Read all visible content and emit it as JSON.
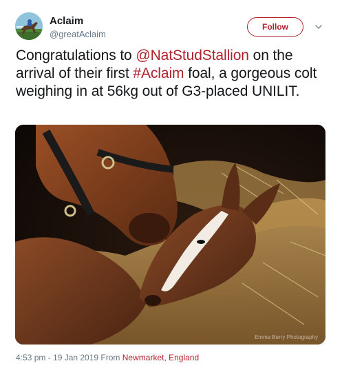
{
  "user": {
    "display_name": "Aclaim",
    "handle": "@greatAclaim"
  },
  "follow_button": {
    "label": "Follow"
  },
  "tweet": {
    "text_part1": "Congratulations to ",
    "mention": "@NatStudStallion",
    "text_part2": " on the arrival of their first ",
    "hashtag": "#Aclaim",
    "text_part3": " foal, a gorgeous colt weighing in at 56kg out of G3-placed UNILIT."
  },
  "photo": {
    "watermark": "Emma Berry Photography"
  },
  "footer": {
    "timestamp": "4:53 pm - 19 Jan 2019",
    "from_label": " From ",
    "location": "Newmarket, England"
  },
  "colors": {
    "accent": "#b0212c",
    "text": "#14171a",
    "secondary": "#657786"
  },
  "icons": {
    "menu": "chevron-down-icon"
  }
}
